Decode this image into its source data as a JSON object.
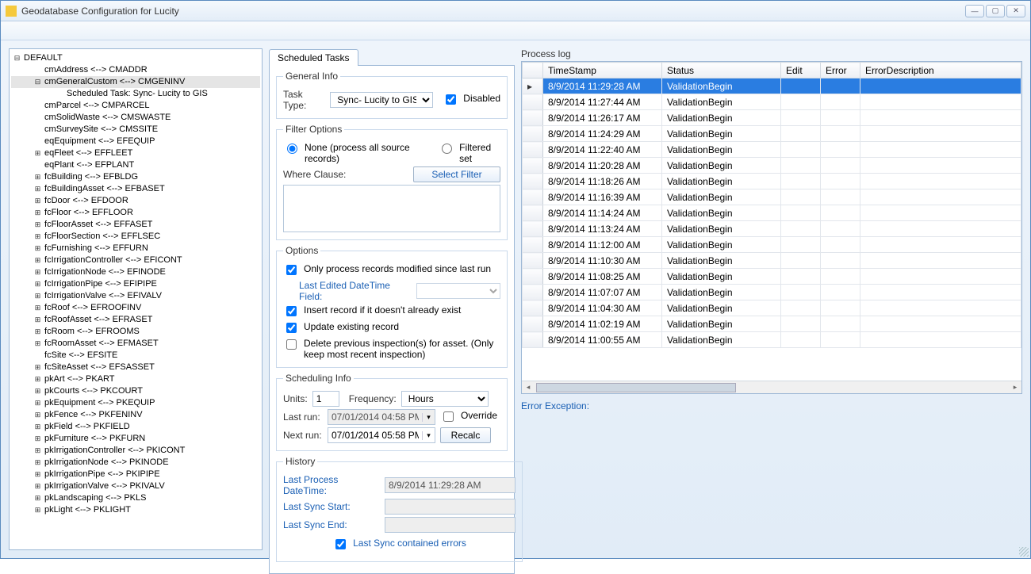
{
  "window": {
    "title": "Geodatabase Configuration for Lucity"
  },
  "tree": {
    "root": {
      "label": "DEFAULT",
      "expanded": true
    },
    "items": [
      {
        "tw": "",
        "label": "cmAddress <--> CMADDR"
      },
      {
        "tw": "-",
        "label": "cmGeneralCustom <--> CMGENINV",
        "depth": 1,
        "selected": true
      },
      {
        "tw": "",
        "label": "Scheduled Task: Sync- Lucity to GIS",
        "depth": 2
      },
      {
        "tw": "",
        "label": "cmParcel <--> CMPARCEL"
      },
      {
        "tw": "",
        "label": "cmSolidWaste <--> CMSWASTE"
      },
      {
        "tw": "",
        "label": "cmSurveySite <--> CMSSITE"
      },
      {
        "tw": "",
        "label": "eqEquipment <--> EFEQUIP"
      },
      {
        "tw": "+",
        "label": "eqFleet <--> EFFLEET"
      },
      {
        "tw": "",
        "label": "eqPlant <--> EFPLANT"
      },
      {
        "tw": "+",
        "label": "fcBuilding <--> EFBLDG"
      },
      {
        "tw": "+",
        "label": "fcBuildingAsset <--> EFBASET"
      },
      {
        "tw": "+",
        "label": "fcDoor <--> EFDOOR"
      },
      {
        "tw": "+",
        "label": "fcFloor <--> EFFLOOR"
      },
      {
        "tw": "+",
        "label": "fcFloorAsset <--> EFFASET"
      },
      {
        "tw": "+",
        "label": "fcFloorSection <--> EFFLSEC"
      },
      {
        "tw": "+",
        "label": "fcFurnishing <--> EFFURN"
      },
      {
        "tw": "+",
        "label": "fcIrrigationController <--> EFICONT"
      },
      {
        "tw": "+",
        "label": "fcIrrigationNode <--> EFINODE"
      },
      {
        "tw": "+",
        "label": "fcIrrigationPipe <--> EFIPIPE"
      },
      {
        "tw": "+",
        "label": "fcIrrigationValve <--> EFIVALV"
      },
      {
        "tw": "+",
        "label": "fcRoof <--> EFROOFINV"
      },
      {
        "tw": "+",
        "label": "fcRoofAsset <--> EFRASET"
      },
      {
        "tw": "+",
        "label": "fcRoom <--> EFROOMS"
      },
      {
        "tw": "+",
        "label": "fcRoomAsset <--> EFMASET"
      },
      {
        "tw": "",
        "label": "fcSite <--> EFSITE"
      },
      {
        "tw": "+",
        "label": "fcSiteAsset <--> EFSASSET"
      },
      {
        "tw": "+",
        "label": "pkArt <--> PKART"
      },
      {
        "tw": "+",
        "label": "pkCourts <--> PKCOURT"
      },
      {
        "tw": "+",
        "label": "pkEquipment <--> PKEQUIP"
      },
      {
        "tw": "+",
        "label": "pkFence <--> PKFENINV"
      },
      {
        "tw": "+",
        "label": "pkField <--> PKFIELD"
      },
      {
        "tw": "+",
        "label": "pkFurniture <--> PKFURN"
      },
      {
        "tw": "+",
        "label": "pkIrrigationController <--> PKICONT"
      },
      {
        "tw": "+",
        "label": "pkIrrigationNode <--> PKINODE"
      },
      {
        "tw": "+",
        "label": "pkIrrigationPipe <--> PKIPIPE"
      },
      {
        "tw": "+",
        "label": "pkIrrigationValve <--> PKIVALV"
      },
      {
        "tw": "+",
        "label": "pkLandscaping <--> PKLS"
      },
      {
        "tw": "+",
        "label": "pkLight <--> PKLIGHT"
      }
    ]
  },
  "mid": {
    "tab": "Scheduled Tasks",
    "general": {
      "legend": "General Info",
      "task_type_label": "Task Type:",
      "task_type_value": "Sync- Lucity to GIS",
      "disabled_label": "Disabled",
      "disabled_checked": true
    },
    "filter": {
      "legend": "Filter Options",
      "opt_none": "None (process all source records)",
      "opt_filtered": "Filtered set",
      "where_label": "Where Clause:",
      "select_filter_btn": "Select Filter",
      "where_value": ""
    },
    "options": {
      "legend": "Options",
      "only_modified": "Only process records modified since last run",
      "last_edited_label": "Last Edited DateTime Field:",
      "last_edited_value": "",
      "insert_new": "Insert record if it doesn't already exist",
      "update_existing": "Update existing record",
      "delete_prev": "Delete previous inspection(s) for asset.  (Only keep most recent inspection)"
    },
    "sched": {
      "legend": "Scheduling Info",
      "units_label": "Units:",
      "units_value": "1",
      "freq_label": "Frequency:",
      "freq_value": "Hours",
      "last_run_label": "Last run:",
      "last_run_value": "07/01/2014 04:58 PM",
      "override_label": "Override",
      "next_run_label": "Next run:",
      "next_run_value": "07/01/2014 05:58 PM",
      "recalc_btn": "Recalc"
    },
    "history": {
      "legend": "History",
      "last_process_label": "Last Process DateTime:",
      "last_process_value": "8/9/2014 11:29:28 AM",
      "last_sync_start_label": "Last Sync Start:",
      "last_sync_start_value": "",
      "last_sync_end_label": "Last Sync End:",
      "last_sync_end_value": "",
      "last_sync_errors_label": "Last Sync contained errors"
    }
  },
  "right": {
    "log_title": "Process log",
    "cols": {
      "ts": "TimeStamp",
      "status": "Status",
      "edit": "Edit",
      "error": "Error",
      "errdesc": "ErrorDescription"
    },
    "rows": [
      {
        "ts": "8/9/2014 11:29:28 AM",
        "status": "ValidationBegin",
        "sel": true
      },
      {
        "ts": "8/9/2014 11:27:44 AM",
        "status": "ValidationBegin"
      },
      {
        "ts": "8/9/2014 11:26:17 AM",
        "status": "ValidationBegin"
      },
      {
        "ts": "8/9/2014 11:24:29 AM",
        "status": "ValidationBegin"
      },
      {
        "ts": "8/9/2014 11:22:40 AM",
        "status": "ValidationBegin"
      },
      {
        "ts": "8/9/2014 11:20:28 AM",
        "status": "ValidationBegin"
      },
      {
        "ts": "8/9/2014 11:18:26 AM",
        "status": "ValidationBegin"
      },
      {
        "ts": "8/9/2014 11:16:39 AM",
        "status": "ValidationBegin"
      },
      {
        "ts": "8/9/2014 11:14:24 AM",
        "status": "ValidationBegin"
      },
      {
        "ts": "8/9/2014 11:13:24 AM",
        "status": "ValidationBegin"
      },
      {
        "ts": "8/9/2014 11:12:00 AM",
        "status": "ValidationBegin"
      },
      {
        "ts": "8/9/2014 11:10:30 AM",
        "status": "ValidationBegin"
      },
      {
        "ts": "8/9/2014 11:08:25 AM",
        "status": "ValidationBegin"
      },
      {
        "ts": "8/9/2014 11:07:07 AM",
        "status": "ValidationBegin"
      },
      {
        "ts": "8/9/2014 11:04:30 AM",
        "status": "ValidationBegin"
      },
      {
        "ts": "8/9/2014 11:02:19 AM",
        "status": "ValidationBegin"
      },
      {
        "ts": "8/9/2014 11:00:55 AM",
        "status": "ValidationBegin"
      }
    ],
    "error_exception_label": "Error Exception:",
    "error_exception_value": ""
  }
}
